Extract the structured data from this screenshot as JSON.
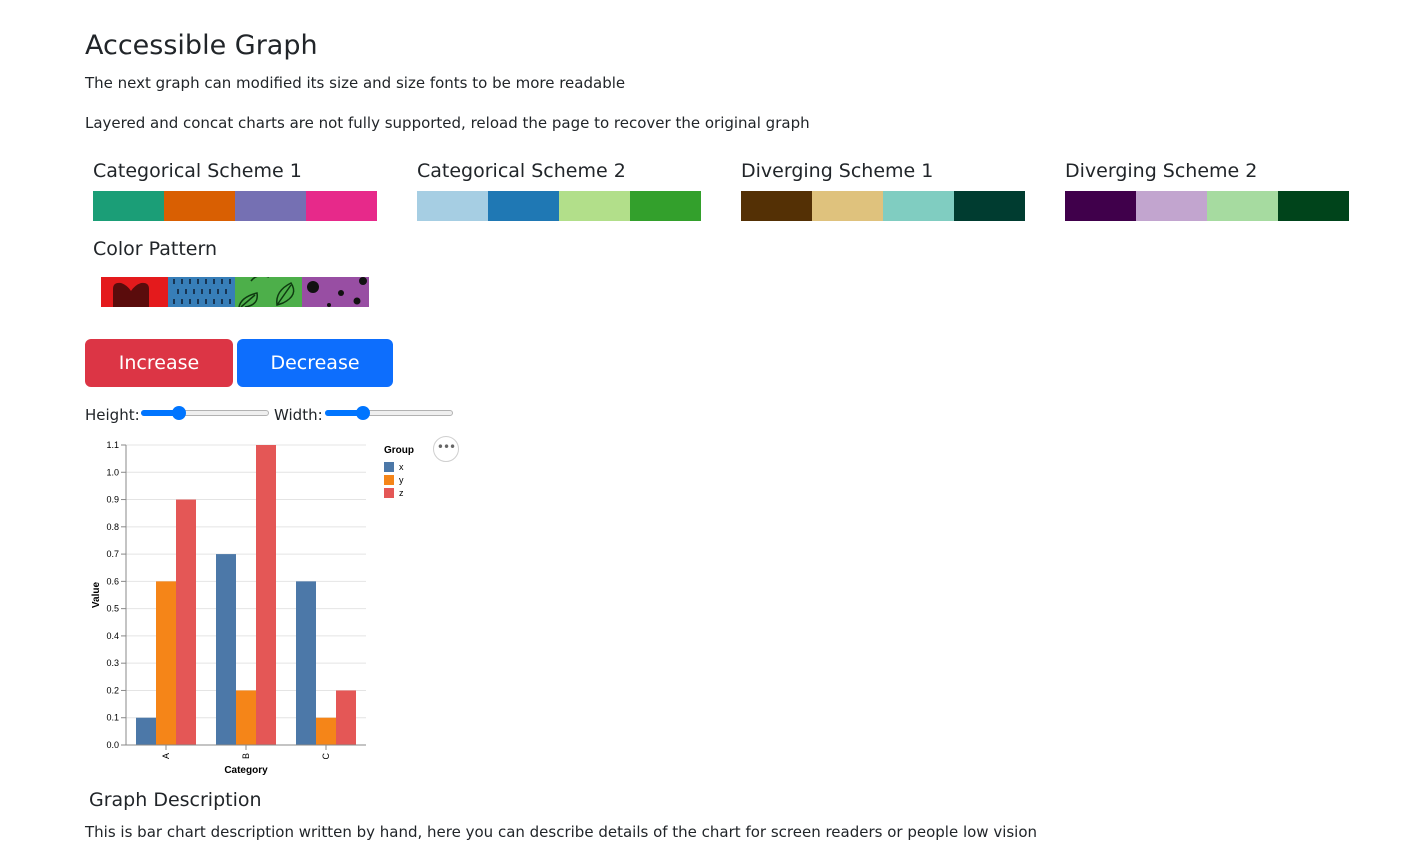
{
  "page": {
    "title": "Accessible Graph",
    "intro": "The next graph can modified its size and size fonts to be more readable",
    "note": "Layered and concat charts are not fully supported, reload the page to recover the original graph"
  },
  "schemes": [
    {
      "title": "Categorical Scheme 1",
      "colors": [
        "#1b9e77",
        "#d95f02",
        "#7570b3",
        "#e7298a"
      ]
    },
    {
      "title": "Categorical Scheme 2",
      "colors": [
        "#a6cee3",
        "#1f78b4",
        "#b2df8a",
        "#33a02c"
      ]
    },
    {
      "title": "Diverging Scheme 1",
      "colors": [
        "#543005",
        "#dfc27d",
        "#80cdc1",
        "#003c30"
      ]
    },
    {
      "title": "Diverging Scheme 2",
      "colors": [
        "#40004b",
        "#c2a5cf",
        "#a6dba0",
        "#00441b"
      ]
    }
  ],
  "pattern": {
    "title": "Color Pattern",
    "colors": [
      "#e41a1c",
      "#377eb8",
      "#4daf4a",
      "#984ea3"
    ]
  },
  "buttons": {
    "increase": "Increase font",
    "decrease": "Decrease font"
  },
  "sliders": {
    "height": {
      "label": "Height:",
      "fraction": 0.3
    },
    "width": {
      "label": "Width:",
      "fraction": 0.3
    }
  },
  "chart_data": {
    "type": "bar",
    "categories": [
      "A",
      "B",
      "C"
    ],
    "series": [
      {
        "name": "x",
        "color": "#4c78a8",
        "values": [
          0.1,
          0.7,
          0.6
        ]
      },
      {
        "name": "y",
        "color": "#f58518",
        "values": [
          0.6,
          0.2,
          0.1
        ]
      },
      {
        "name": "z",
        "color": "#e45756",
        "values": [
          0.9,
          1.1,
          0.2
        ]
      }
    ],
    "xlabel": "Category",
    "ylabel": "Value",
    "legend_title": "Group",
    "legend_position": "right",
    "ylim": [
      0,
      1.1
    ],
    "yticks": [
      "0.0",
      "0.1",
      "0.2",
      "0.3",
      "0.4",
      "0.5",
      "0.6",
      "0.7",
      "0.8",
      "0.9",
      "1.0",
      "1.1"
    ],
    "grid": true,
    "menu_icon": "ellipsis-icon"
  },
  "description": {
    "title": "Graph Description",
    "text": "This is bar chart description written by hand, here you can describe details of the chart for screen readers or people low vision"
  }
}
